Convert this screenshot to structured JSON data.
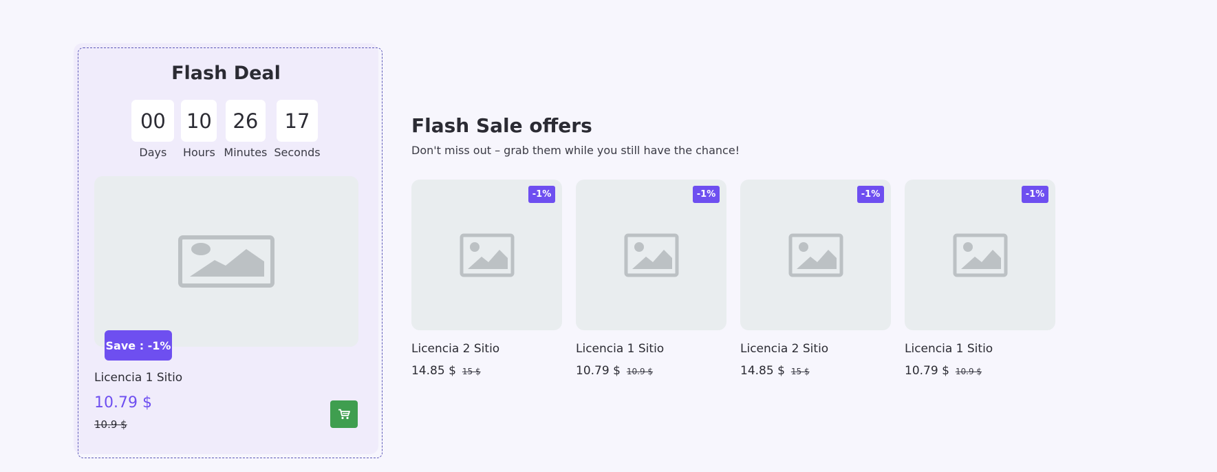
{
  "flash_deal": {
    "title": "Flash Deal",
    "countdown": [
      {
        "value": "00",
        "label": "Days"
      },
      {
        "value": "10",
        "label": "Hours"
      },
      {
        "value": "26",
        "label": "Minutes"
      },
      {
        "value": "17",
        "label": "Seconds"
      }
    ],
    "image_icon": "image-placeholder-icon",
    "save_badge": "Save : -1%",
    "product_name": "Licencia 1 Sitio",
    "price": "10.79 $",
    "old_price": "10.9 $",
    "cart_icon": "cart-icon",
    "cart_color": "#3f9e4f"
  },
  "sale": {
    "title": "Flash Sale offers",
    "subtitle": "Don't miss out – grab them while you still have the chance!",
    "products": [
      {
        "badge": "-1%",
        "name": "Licencia 2 Sitio",
        "price": "14.85 $",
        "old_price": "15 $"
      },
      {
        "badge": "-1%",
        "name": "Licencia 1 Sitio",
        "price": "10.79 $",
        "old_price": "10.9 $"
      },
      {
        "badge": "-1%",
        "name": "Licencia 2 Sitio",
        "price": "14.85 $",
        "old_price": "15 $"
      },
      {
        "badge": "-1%",
        "name": "Licencia 1 Sitio",
        "price": "10.79 $",
        "old_price": "10.9 $"
      }
    ]
  },
  "colors": {
    "accent": "#6e4ff0",
    "background": "#f7f6fd",
    "card": "#f0ecfb",
    "placeholder": "#e9edef"
  }
}
